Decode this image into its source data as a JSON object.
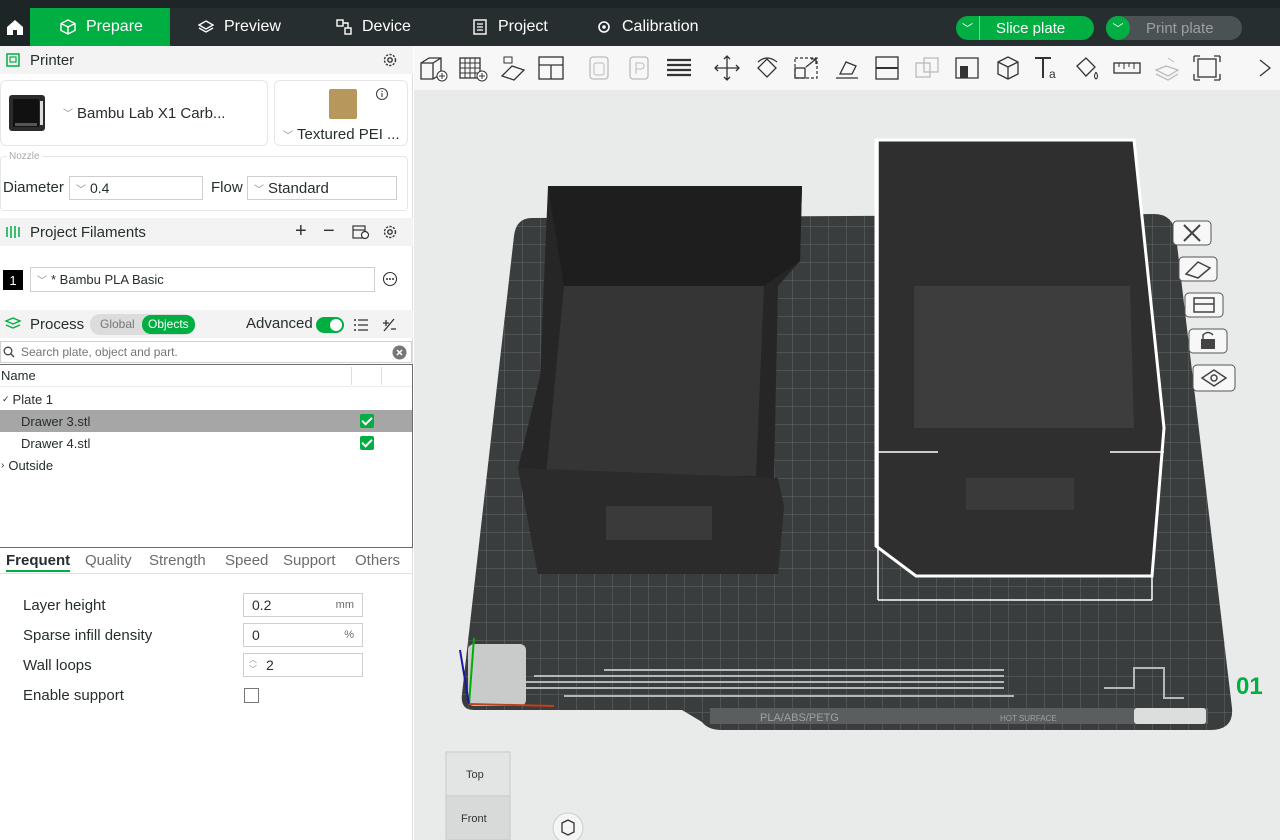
{
  "topbar": {
    "tabs": [
      {
        "label": "Prepare",
        "icon": "cube-icon",
        "active": true
      },
      {
        "label": "Preview",
        "icon": "layers-icon",
        "active": false
      },
      {
        "label": "Device",
        "icon": "device-icon",
        "active": false
      },
      {
        "label": "Project",
        "icon": "project-icon",
        "active": false
      },
      {
        "label": "Calibration",
        "icon": "calibration-icon",
        "active": false
      }
    ],
    "slice_label": "Slice plate",
    "print_label": "Print plate"
  },
  "printer": {
    "section_title": "Printer",
    "printer_name": "Bambu Lab X1 Carb...",
    "plate_name": "Textured PEI ...",
    "nozzle_legend": "Nozzle",
    "diameter_label": "Diameter",
    "diameter_value": "0.4",
    "flow_label": "Flow",
    "flow_value": "Standard"
  },
  "filaments": {
    "section_title": "Project Filaments",
    "items": [
      {
        "index": "1",
        "name": "* Bambu PLA Basic"
      }
    ]
  },
  "process": {
    "section_title": "Process",
    "mode_global": "Global",
    "mode_objects": "Objects",
    "advanced_label": "Advanced",
    "advanced_on": true,
    "search_placeholder": "Search plate, object and part.",
    "tree_header": "Name",
    "tree": [
      {
        "label": "Plate 1",
        "level": 0,
        "expanded": true
      },
      {
        "label": "Drawer 3.stl",
        "level": 1,
        "selected": true,
        "checked": true
      },
      {
        "label": "Drawer 4.stl",
        "level": 1,
        "selected": false,
        "checked": true
      },
      {
        "label": "Outside",
        "level": 0,
        "expanded": false
      }
    ],
    "tabs": [
      "Frequent",
      "Quality",
      "Strength",
      "Speed",
      "Support",
      "Others"
    ],
    "active_tab": "Frequent",
    "params": [
      {
        "label": "Layer height",
        "value": "0.2",
        "unit": "mm"
      },
      {
        "label": "Sparse infill density",
        "value": "0",
        "unit": "%"
      },
      {
        "label": "Wall loops",
        "value": "2",
        "unit": ""
      },
      {
        "label": "Enable support",
        "value": "",
        "unit": ""
      }
    ]
  },
  "viewport": {
    "plate_number": "01",
    "plate_marking": "PLA/ABS/PETG",
    "plate_marking2": "HOT SURFACE",
    "cube_top": "Top",
    "cube_front": "Front"
  },
  "colors": {
    "accent": "#00ae42",
    "topbar": "#262e30",
    "bed": "#3a3d3d",
    "object": "#2a2a2a"
  }
}
